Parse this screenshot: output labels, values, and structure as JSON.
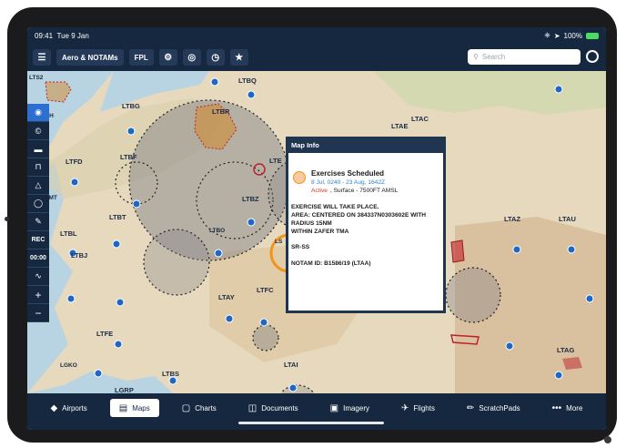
{
  "status": {
    "time": "09:41",
    "date": "Tue 9 Jan",
    "battery": "100%"
  },
  "toolbar": {
    "layers_label": "Aero & NOTAMs",
    "fpl_label": "FPL",
    "search_placeholder": "Search"
  },
  "sidebar": {
    "rec_label": "REC",
    "timer": "00:00"
  },
  "map_labels": {
    "ltbq": "LTBQ",
    "ltbr": "LTBR",
    "ltbg": "LTBG",
    "ltbh": "LTBH",
    "ltbf": "LTBF",
    "ltfd": "LTFD",
    "ltbz": "LTBZ",
    "ltbo": "LTBO",
    "ltbt": "LTBT",
    "ltbl": "LTBL",
    "ltbj": "LTBJ",
    "ltay": "LTAY",
    "ltfc": "LTFC",
    "ltfe": "LTFE",
    "ltai": "LTAI",
    "ltbs": "LTBS",
    "lgko": "LGKO",
    "lgrp": "LGRP",
    "ltae": "LTAE",
    "ltac": "LTAC",
    "ltaz": "LTAZ",
    "ltau": "LTAU",
    "ltag": "LTAG",
    "ltmt": "LTMT",
    "lte": "LTE",
    "ls": "LS",
    "lts2": "LTS2"
  },
  "popup": {
    "title": "Map Info",
    "heading": "Exercises Scheduled",
    "dates": "8 Jul, 0240 - 23 Aug, 1642Z",
    "status_word": "Active",
    "status_rest": ", Surface - 7500FT AMSL",
    "body1": "EXERCISE WILL TAKE PLACE.",
    "body2": "AREA: CENTERED ON 384337N0303602E WITH",
    "body3": "RADIUS 15NM",
    "body4": "WITHIN ZAFER TMA",
    "body5": "SR-SS",
    "body6": "NOTAM ID: B1586/19 (LTAA)"
  },
  "tabs": [
    {
      "label": "Airports",
      "icon": "airport-icon"
    },
    {
      "label": "Maps",
      "icon": "map-icon"
    },
    {
      "label": "Charts",
      "icon": "chart-icon"
    },
    {
      "label": "Documents",
      "icon": "documents-icon"
    },
    {
      "label": "Imagery",
      "icon": "imagery-icon"
    },
    {
      "label": "Flights",
      "icon": "plane-icon"
    },
    {
      "label": "ScratchPads",
      "icon": "pencil-icon"
    },
    {
      "label": "More",
      "icon": "more-icon"
    }
  ],
  "colors": {
    "nav": "#16283f",
    "accent": "#2d6fd0",
    "active": "#d9342b",
    "dates": "#2f7fd3",
    "airport": "#1f67c7"
  }
}
